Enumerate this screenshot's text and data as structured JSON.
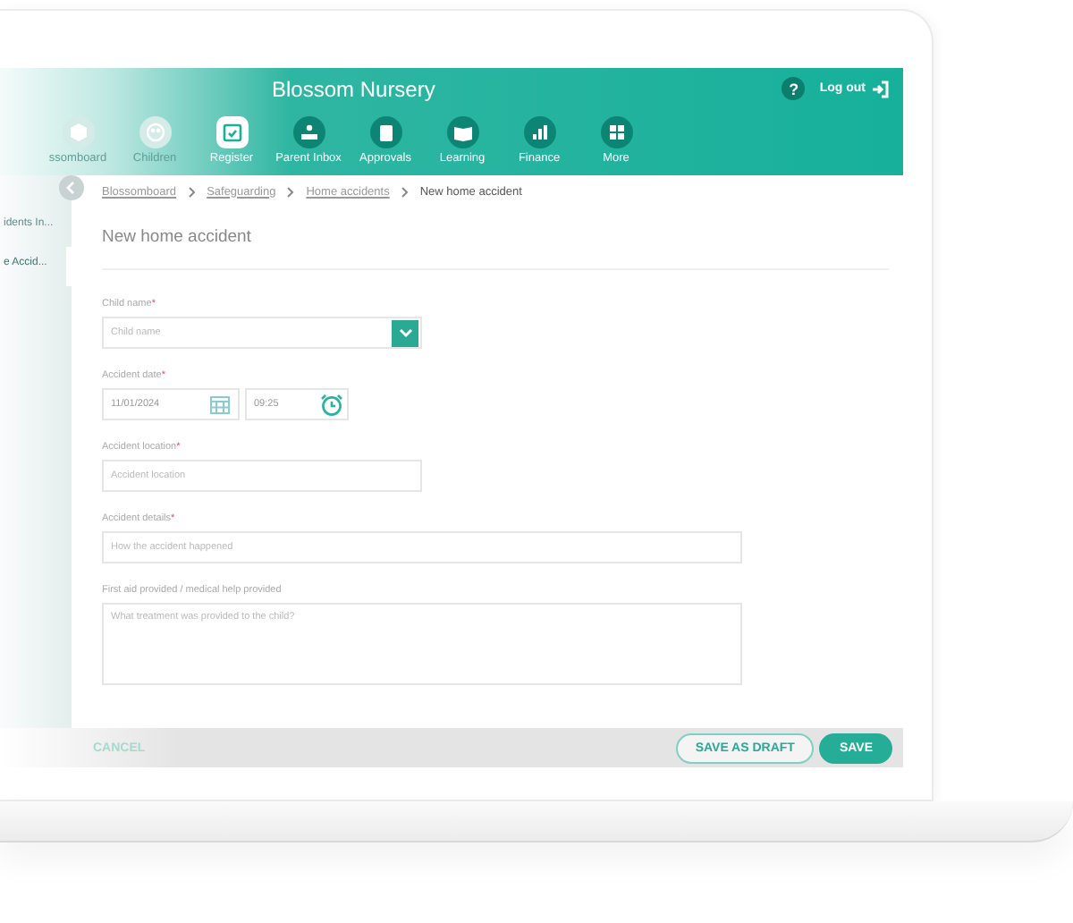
{
  "header": {
    "title": "Blossom Nursery",
    "help": "?",
    "logout": "Log out"
  },
  "nav": [
    {
      "label": "ssomboard",
      "selected": false
    },
    {
      "label": "Children",
      "selected": false
    },
    {
      "label": "Register",
      "selected": true
    },
    {
      "label": "Parent Inbox",
      "selected": false
    },
    {
      "label": "Approvals",
      "selected": false
    },
    {
      "label": "Learning",
      "selected": false
    },
    {
      "label": "Finance",
      "selected": false
    },
    {
      "label": "More",
      "selected": false
    }
  ],
  "sidebar": {
    "items": [
      {
        "label": "idents In...",
        "selected": false
      },
      {
        "label": "e Accid...",
        "selected": true
      }
    ]
  },
  "breadcrumbs": [
    {
      "label": "Blossomboard",
      "link": true
    },
    {
      "label": "Safeguarding",
      "link": true
    },
    {
      "label": "Home accidents",
      "link": true
    },
    {
      "label": "New home accident",
      "link": false
    }
  ],
  "form": {
    "title": "New home accident",
    "fields": [
      {
        "kind": "select",
        "label": "Child name",
        "mark": "*",
        "placeholder": "Child name"
      },
      {
        "kind": "datetime",
        "label": "Accident date",
        "mark": "*",
        "date": "11/01/2024",
        "time": "09:25"
      },
      {
        "kind": "text",
        "label": "Accident location",
        "mark": "*",
        "placeholder": "Accident location"
      },
      {
        "kind": "wide",
        "label": "Accident details",
        "mark": "*",
        "placeholder": "How the accident happened"
      },
      {
        "kind": "area",
        "label": "First aid provided / medical help provided",
        "placeholder": "What treatment was provided to the child?"
      }
    ]
  },
  "footer": {
    "cancel": "CANCEL",
    "draft": "SAVE AS DRAFT",
    "save": "SAVE"
  }
}
